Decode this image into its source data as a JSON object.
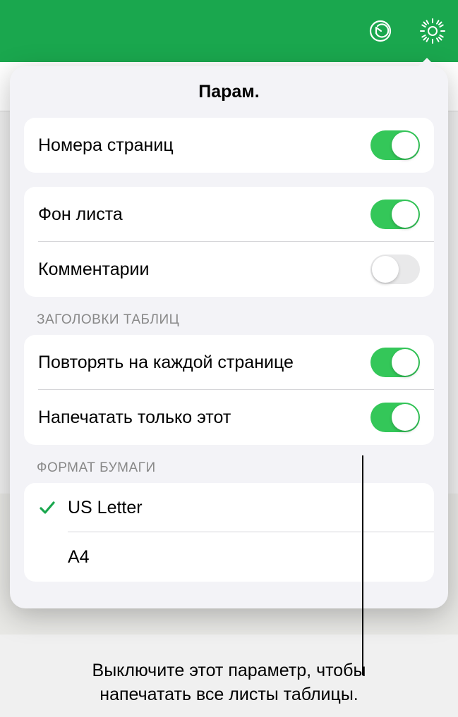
{
  "header": {
    "title": "Парам."
  },
  "options": {
    "page_numbers": {
      "label": "Номера страниц",
      "value": true
    },
    "sheet_background": {
      "label": "Фон листа",
      "value": true
    },
    "comments": {
      "label": "Комментарии",
      "value": false
    }
  },
  "table_headers": {
    "section_label": "ЗАГОЛОВКИ ТАБЛИЦ",
    "repeat_each_page": {
      "label": "Повторять на каждой странице",
      "value": true
    },
    "print_only_this": {
      "label": "Напечатать только этот",
      "value": true
    }
  },
  "paper_format": {
    "section_label": "ФОРМАТ БУМАГИ",
    "items": [
      {
        "label": "US Letter",
        "selected": true
      },
      {
        "label": "A4",
        "selected": false
      }
    ]
  },
  "callout": {
    "text": "Выключите этот параметр, чтобы напечатать все листы таблицы."
  }
}
